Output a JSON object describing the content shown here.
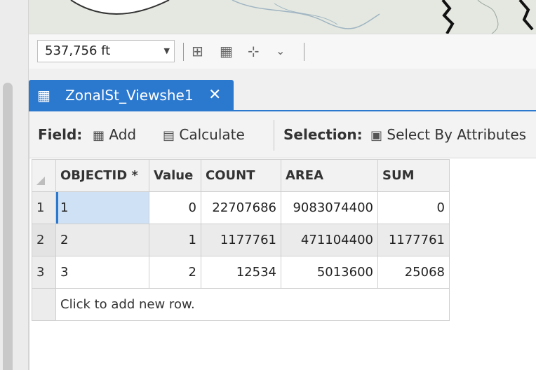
{
  "map_bar": {
    "scale_value": "537,756 ft"
  },
  "tab": {
    "title": "ZonalSt_Viewshe1",
    "close_symbol": "✕"
  },
  "toolbar": {
    "field_label": "Field:",
    "add_label": "Add",
    "calculate_label": "Calculate",
    "selection_label": "Selection:",
    "select_by_attributes_label": "Select By Attributes"
  },
  "table": {
    "headers": [
      "OBJECTID *",
      "Value",
      "COUNT",
      "AREA",
      "SUM"
    ],
    "rows": [
      {
        "row_num": "1",
        "objectid": "1",
        "value": "0",
        "count": "22707686",
        "area": "9083074400",
        "sum": "0"
      },
      {
        "row_num": "2",
        "objectid": "2",
        "value": "1",
        "count": "1177761",
        "area": "471104400",
        "sum": "1177761"
      },
      {
        "row_num": "3",
        "objectid": "3",
        "value": "2",
        "count": "12534",
        "area": "5013600",
        "sum": "25068"
      }
    ],
    "new_row_text": "Click to add new row."
  },
  "colors": {
    "accent": "#2b78cf",
    "selected_cell": "#cfe1f5"
  },
  "icons": {
    "tab_icon": "table-icon",
    "add_icon": "add-field-icon",
    "calculate_icon": "calculate-icon",
    "select_icon": "select-by-attributes-icon"
  }
}
